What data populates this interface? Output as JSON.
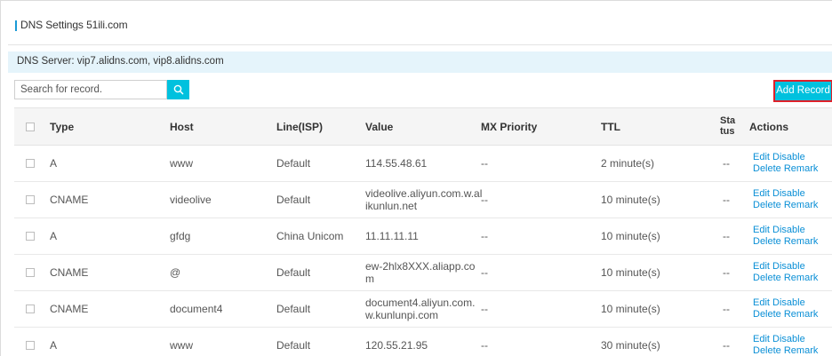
{
  "title": "DNS Settings 51ili.com",
  "dns_server": "DNS Server: vip7.alidns.com, vip8.alidns.com",
  "search": {
    "placeholder": "Search for record."
  },
  "add_record_label": "Add Record",
  "columns": {
    "type": "Type",
    "host": "Host",
    "line": "Line(ISP)",
    "value": "Value",
    "mx": "MX Priority",
    "ttl": "TTL",
    "status_1": "Sta",
    "status_2": "tus",
    "actions": "Actions"
  },
  "action_labels": {
    "edit": "Edit",
    "disable": "Disable",
    "delete": "Delete",
    "remark": "Remark"
  },
  "records": [
    {
      "type": "A",
      "host": "www",
      "line": "Default",
      "value_1": "114.55.48.61",
      "value_2": "",
      "mx": "--",
      "ttl": "2 minute(s)",
      "status": "--"
    },
    {
      "type": "CNAME",
      "host": "videolive",
      "line": "Default",
      "value_1": "videolive.aliyun.com.w.al",
      "value_2": "ikunlun.net",
      "mx": "--",
      "ttl": "10 minute(s)",
      "status": "--"
    },
    {
      "type": "A",
      "host": "gfdg",
      "line": "China Unicom",
      "value_1": "11.11.11.11",
      "value_2": "",
      "mx": "--",
      "ttl": "10 minute(s)",
      "status": "--"
    },
    {
      "type": "CNAME",
      "host": "@",
      "line": "Default",
      "value_1": "ew-2hlx8XXX.aliapp.co",
      "value_2": "m",
      "mx": "--",
      "ttl": "10 minute(s)",
      "status": "--"
    },
    {
      "type": "CNAME",
      "host": "document4",
      "line": "Default",
      "value_1": "document4.aliyun.com.",
      "value_2": "w.kunlunpi.com",
      "mx": "--",
      "ttl": "10 minute(s)",
      "status": "--"
    },
    {
      "type": "A",
      "host": "www",
      "line": "Default",
      "value_1": "120.55.21.95",
      "value_2": "",
      "mx": "--",
      "ttl": "30 minute(s)",
      "status": "--"
    }
  ]
}
